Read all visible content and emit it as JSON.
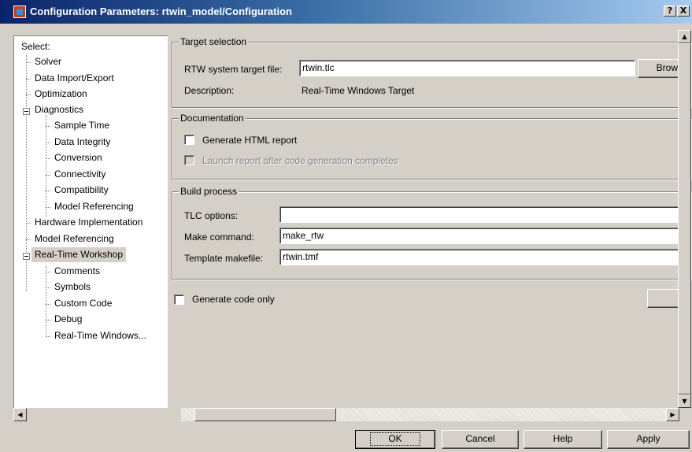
{
  "window": {
    "title": "Configuration Parameters: rtwin_model/Configuration",
    "help_btn": "?",
    "close_btn": "X"
  },
  "tree": {
    "header": "Select:",
    "items": [
      {
        "label": "Solver"
      },
      {
        "label": "Data Import/Export"
      },
      {
        "label": "Optimization"
      },
      {
        "label": "Diagnostics"
      },
      {
        "label": "Sample Time"
      },
      {
        "label": "Data Integrity"
      },
      {
        "label": "Conversion"
      },
      {
        "label": "Connectivity"
      },
      {
        "label": "Compatibility"
      },
      {
        "label": "Model Referencing"
      },
      {
        "label": "Hardware Implementation"
      },
      {
        "label": "Model Referencing"
      },
      {
        "label": "Real-Time Workshop"
      },
      {
        "label": "Comments"
      },
      {
        "label": "Symbols"
      },
      {
        "label": "Custom Code"
      },
      {
        "label": "Debug"
      },
      {
        "label": "Real-Time Windows..."
      }
    ],
    "selected": "Real-Time Workshop"
  },
  "target_selection": {
    "title": "Target selection",
    "target_file_label": "RTW system target file:",
    "target_file_value": "rtwin.tlc",
    "browse_label": "Brow",
    "description_label": "Description:",
    "description_value": "Real-Time Windows Target"
  },
  "documentation": {
    "title": "Documentation",
    "generate_html_label": "Generate HTML report",
    "generate_html_checked": false,
    "launch_report_label": "Launch report after code generation completes",
    "launch_report_checked": false
  },
  "build_process": {
    "title": "Build process",
    "tlc_options_label": "TLC options:",
    "tlc_options_value": "",
    "make_command_label": "Make command:",
    "make_command_value": "make_rtw",
    "template_makefile_label": "Template makefile:",
    "template_makefile_value": "rtwin.tmf"
  },
  "generate_code_only": {
    "label": "Generate code only",
    "checked": false
  },
  "buttons": {
    "ok": "OK",
    "cancel": "Cancel",
    "help": "Help",
    "apply": "Apply"
  },
  "icons": {
    "app": "simulink-config-icon",
    "scroll_up": "▲",
    "scroll_down": "▼",
    "scroll_left": "◀",
    "scroll_right": "▶"
  }
}
